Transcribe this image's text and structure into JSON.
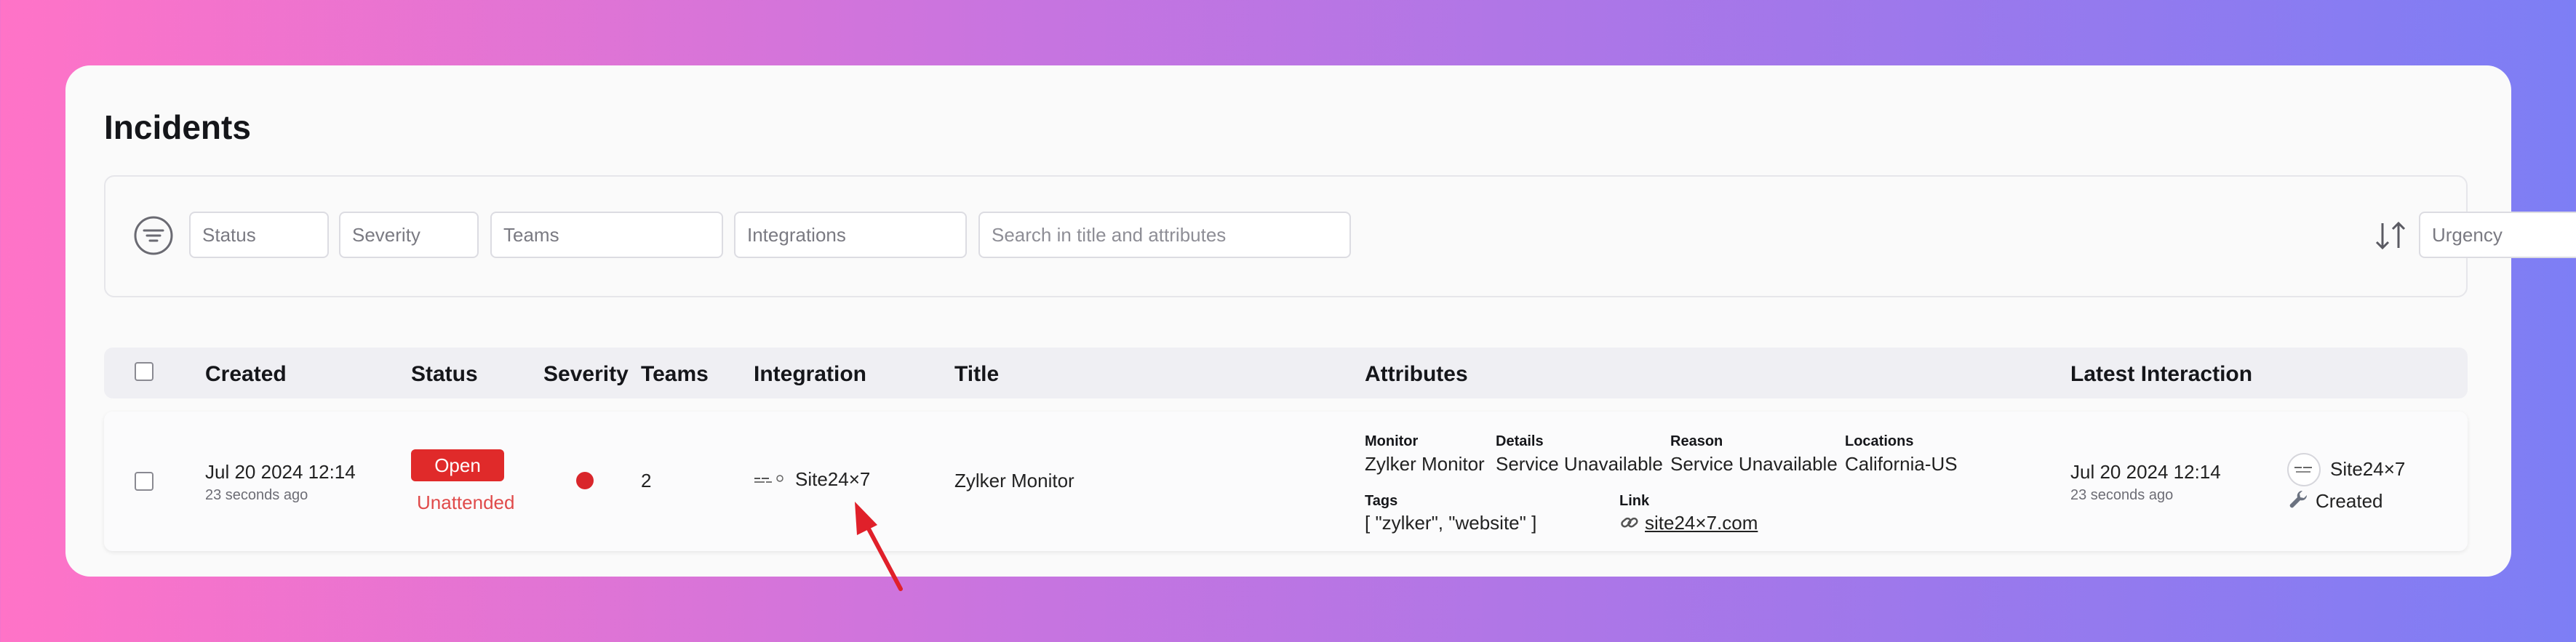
{
  "page": {
    "title": "Incidents"
  },
  "filters": {
    "status_placeholder": "Status",
    "severity_placeholder": "Severity",
    "teams_placeholder": "Teams",
    "integrations_placeholder": "Integrations",
    "search_placeholder": "Search in title and attributes",
    "urgency_placeholder": "Urgency",
    "icons": {
      "filter": "filter-icon",
      "sort": "sort-icon"
    }
  },
  "table": {
    "headers": {
      "created": "Created",
      "status": "Status",
      "severity": "Severity",
      "teams": "Teams",
      "integration": "Integration",
      "title": "Title",
      "attributes": "Attributes",
      "latest_interaction": "Latest Interaction"
    },
    "rows": [
      {
        "created_date": "Jul 20 2024 12:14",
        "created_ago": "23 seconds ago",
        "status": "Open",
        "status_sub": "Unattended",
        "severity_color": "#d9262b",
        "teams": "2",
        "integration": "Site24×7",
        "title": "Zylker Monitor",
        "attributes": {
          "monitor_label": "Monitor",
          "monitor": "Zylker Monitor",
          "details_label": "Details",
          "details": "Service Unavailable",
          "reason_label": "Reason",
          "reason": "Service Unavailable",
          "locations_label": "Locations",
          "locations": "California-US",
          "tags_label": "Tags",
          "tags": "[ \"zylker\", \"website\" ]",
          "link_label": "Link",
          "link": "site24×7.com"
        },
        "latest_date": "Jul 20 2024 12:14",
        "latest_ago": "23 seconds ago",
        "latest_source": "Site24×7",
        "latest_action": "Created"
      }
    ]
  },
  "colors": {
    "open_badge": "#e02a2a",
    "unattended": "#e04a4a",
    "annotation_arrow": "#e0202a"
  }
}
